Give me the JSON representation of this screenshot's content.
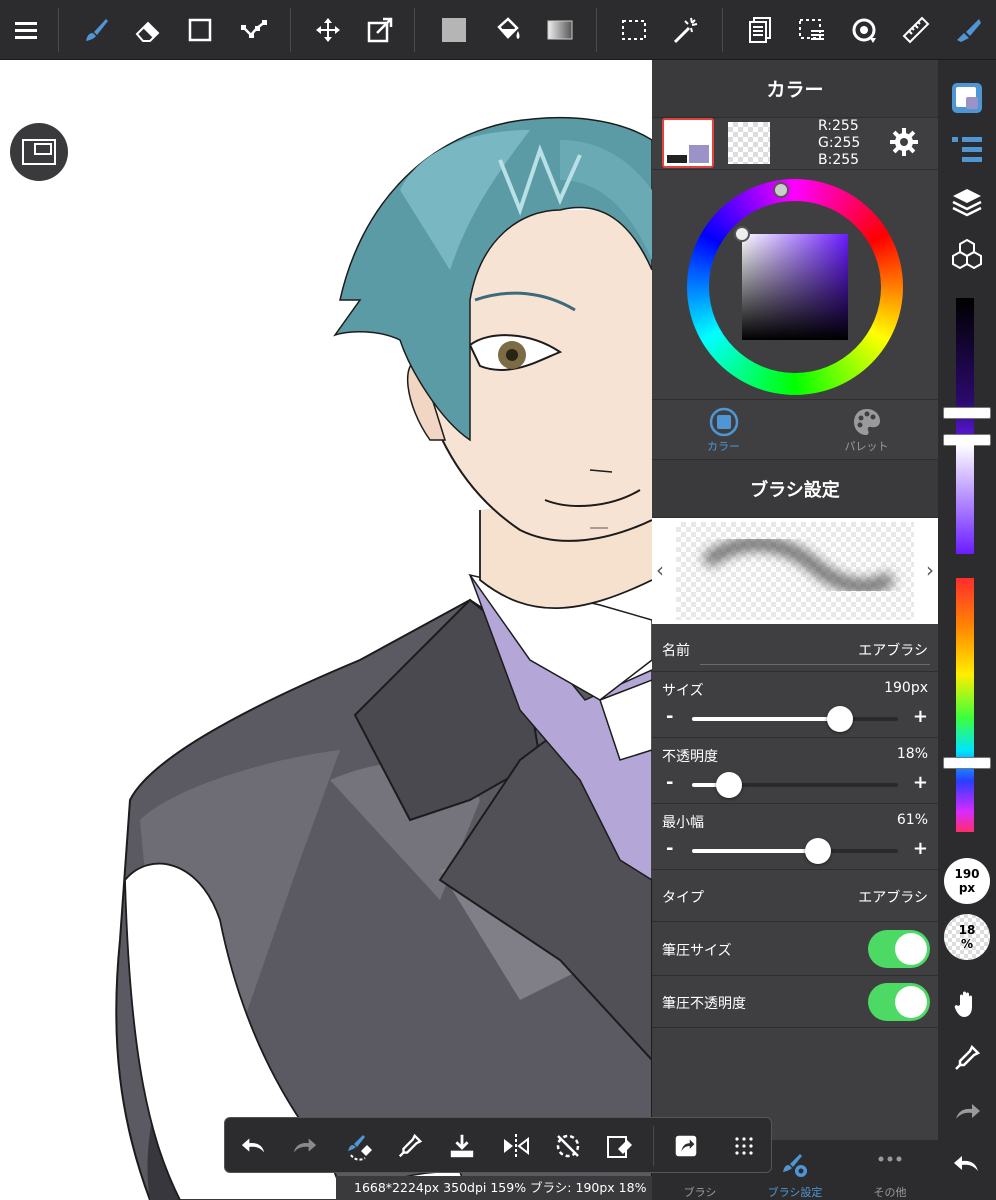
{
  "toolbar": {
    "items": [
      "menu-icon",
      "brush-icon",
      "eraser-icon",
      "rectangle-icon",
      "polyline-icon",
      "move-icon",
      "transform-icon",
      "fill-color-icon",
      "bucket-icon",
      "gradient-icon",
      "selection-icon",
      "magic-wand-icon",
      "layers-doc-icon",
      "select-layer-icon",
      "rotate-icon",
      "ruler-icon",
      "pen-active-icon"
    ],
    "accent": "#4f97d4"
  },
  "color_panel": {
    "title": "カラー",
    "r": "R:255",
    "g": "G:255",
    "b": "B:255",
    "tab_color": "カラー",
    "tab_palette": "パレット"
  },
  "brush_panel": {
    "title": "ブラシ設定",
    "name_label": "名前",
    "name_value": "エアブラシ",
    "size_label": "サイズ",
    "size_value": "190px",
    "size_level": 0.72,
    "opacity_label": "不透明度",
    "opacity_value": "18%",
    "opacity_level": 0.18,
    "minwidth_label": "最小幅",
    "minwidth_value": "61%",
    "minwidth_level": 0.61,
    "type_label": "タイプ",
    "type_value": "エアブラシ",
    "pressure_size_label": "筆圧サイズ",
    "pressure_size_on": true,
    "pressure_opacity_label": "筆圧不透明度",
    "pressure_opacity_on": true,
    "minus": "-",
    "plus": "+"
  },
  "panel_dock": {
    "brush": "ブラシ",
    "brush_settings": "ブラシ設定",
    "other": "その他"
  },
  "right_column": {
    "size_chip_num": "190",
    "size_chip_unit": "px",
    "opacity_chip_num": "18",
    "opacity_chip_unit": "%"
  },
  "bottom_toolbar": {
    "items": [
      "undo-icon",
      "redo-icon",
      "brush-swap-icon",
      "eyedropper-icon",
      "import-icon",
      "flip-icon",
      "rotate-reset-icon",
      "clear-icon",
      "share-icon",
      "grid-icon"
    ]
  },
  "status": {
    "text": "1668*2224px 350dpi 159% ブラシ: 190px 18%"
  }
}
